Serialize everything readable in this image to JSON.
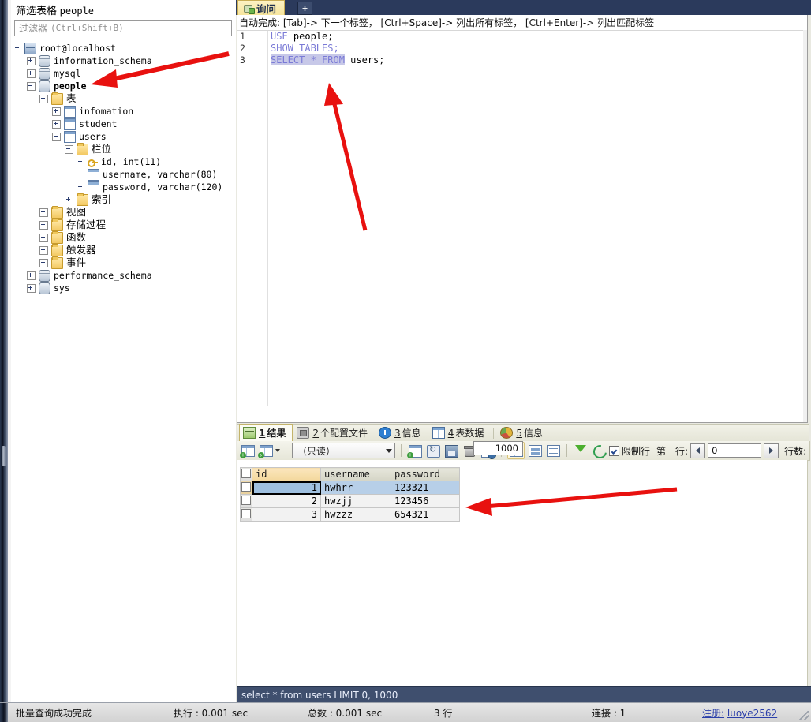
{
  "left_panel": {
    "filter_title_prefix": "筛选表格",
    "filter_title_table": "people",
    "filter_placeholder": "过滤器",
    "filter_shortcut": "(Ctrl+Shift+B)",
    "tree": [
      {
        "label": "root@localhost",
        "icon": "server-icon",
        "indent": 0,
        "expander": "none",
        "bold": false,
        "cn": false
      },
      {
        "label": "information_schema",
        "icon": "database-icon",
        "indent": 1,
        "expander": "plus",
        "bold": false,
        "cn": false
      },
      {
        "label": "mysql",
        "icon": "database-icon",
        "indent": 1,
        "expander": "plus",
        "bold": false,
        "cn": false
      },
      {
        "label": "people",
        "icon": "database-icon",
        "indent": 1,
        "expander": "minus",
        "bold": true,
        "cn": false
      },
      {
        "label": "表",
        "icon": "folder-icon",
        "indent": 2,
        "expander": "minus",
        "bold": false,
        "cn": true
      },
      {
        "label": "infomation",
        "icon": "table-icon",
        "indent": 3,
        "expander": "plus",
        "bold": false,
        "cn": false
      },
      {
        "label": "student",
        "icon": "table-icon",
        "indent": 3,
        "expander": "plus",
        "bold": false,
        "cn": false
      },
      {
        "label": "users",
        "icon": "table-icon",
        "indent": 3,
        "expander": "minus",
        "bold": false,
        "cn": false
      },
      {
        "label": "栏位",
        "icon": "folder-icon",
        "indent": 4,
        "expander": "minus",
        "bold": false,
        "cn": true
      },
      {
        "label": "id, int(11)",
        "icon": "key-icon",
        "indent": 5,
        "expander": "none",
        "bold": false,
        "cn": false
      },
      {
        "label": "username, varchar(80)",
        "icon": "column-icon",
        "indent": 5,
        "expander": "none",
        "bold": false,
        "cn": false
      },
      {
        "label": "password, varchar(120)",
        "icon": "column-icon",
        "indent": 5,
        "expander": "none",
        "bold": false,
        "cn": false
      },
      {
        "label": "索引",
        "icon": "folder-icon",
        "indent": 4,
        "expander": "plus",
        "bold": false,
        "cn": true
      },
      {
        "label": "视图",
        "icon": "folder-icon",
        "indent": 2,
        "expander": "plus",
        "bold": false,
        "cn": true
      },
      {
        "label": "存储过程",
        "icon": "folder-icon",
        "indent": 2,
        "expander": "plus",
        "bold": false,
        "cn": true
      },
      {
        "label": "函数",
        "icon": "folder-icon",
        "indent": 2,
        "expander": "plus",
        "bold": false,
        "cn": true
      },
      {
        "label": "触发器",
        "icon": "folder-icon",
        "indent": 2,
        "expander": "plus",
        "bold": false,
        "cn": true
      },
      {
        "label": "事件",
        "icon": "folder-icon",
        "indent": 2,
        "expander": "plus",
        "bold": false,
        "cn": true
      },
      {
        "label": "performance_schema",
        "icon": "database-icon",
        "indent": 1,
        "expander": "plus",
        "bold": false,
        "cn": false
      },
      {
        "label": "sys",
        "icon": "database-icon",
        "indent": 1,
        "expander": "plus",
        "bold": false,
        "cn": false
      }
    ]
  },
  "editor": {
    "tab_label": "询问",
    "add_tab_label": "+",
    "autocomplete_hint": "自动完成: [Tab]-> 下一个标签， [Ctrl+Space]-> 列出所有标签， [Ctrl+Enter]-> 列出匹配标签",
    "lines": [
      {
        "n": "1",
        "keyword": "USE",
        "rest": " people;",
        "selected": false
      },
      {
        "n": "2",
        "keyword": "SHOW TABLES;",
        "rest": "",
        "selected": false
      },
      {
        "n": "3",
        "keyword": "SELECT * FROM",
        "rest": " users;",
        "selected": true
      }
    ]
  },
  "results": {
    "tabs": [
      {
        "num": "1",
        "label": "结果",
        "icon": "result-grid-icon",
        "active": true
      },
      {
        "num": "2",
        "label": "个配置文件",
        "icon": "profile-icon",
        "active": false
      },
      {
        "num": "3",
        "label": "信息",
        "icon": "info-icon",
        "active": false
      },
      {
        "num": "4",
        "label": "表数据",
        "icon": "table-data-icon",
        "active": false
      },
      {
        "num": "5",
        "label": "信息",
        "icon": "pie-chart-icon",
        "active": false
      }
    ],
    "toolbar": {
      "mode_select_value": "（只读）",
      "limit_rows_label": "限制行",
      "limit_rows_checked": true,
      "first_row_label": "第一行:",
      "first_row_value": "0",
      "row_count_label": "行数:",
      "row_count_value": "1000"
    },
    "grid": {
      "columns": [
        "id",
        "username",
        "password"
      ],
      "active_column": "id",
      "rows": [
        {
          "id": "1",
          "username": "hwhrr",
          "password": "123321",
          "selected": true
        },
        {
          "id": "2",
          "username": "hwzjj",
          "password": "123456",
          "selected": false
        },
        {
          "id": "3",
          "username": "hwzzz",
          "password": "654321",
          "selected": false
        }
      ]
    },
    "sql_line": "select * from users LIMIT 0, 1000"
  },
  "statusbar": {
    "message": "批量查询成功完成",
    "exec_time": "执行 : 0.001 sec",
    "total_time": "总数 : 0.001 sec",
    "row_count": "3 行",
    "connections": "连接 : 1",
    "register_label": "注册:",
    "register_user": "luoye2562"
  },
  "colors": {
    "accent_tab": "#f6e49a",
    "titlebar": "#2b3a5c",
    "sql_bar": "#3f4f6e",
    "selection": "#c7c8e8",
    "row_selected": "#b7cfe8",
    "annotation_arrow": "#e8110f"
  }
}
